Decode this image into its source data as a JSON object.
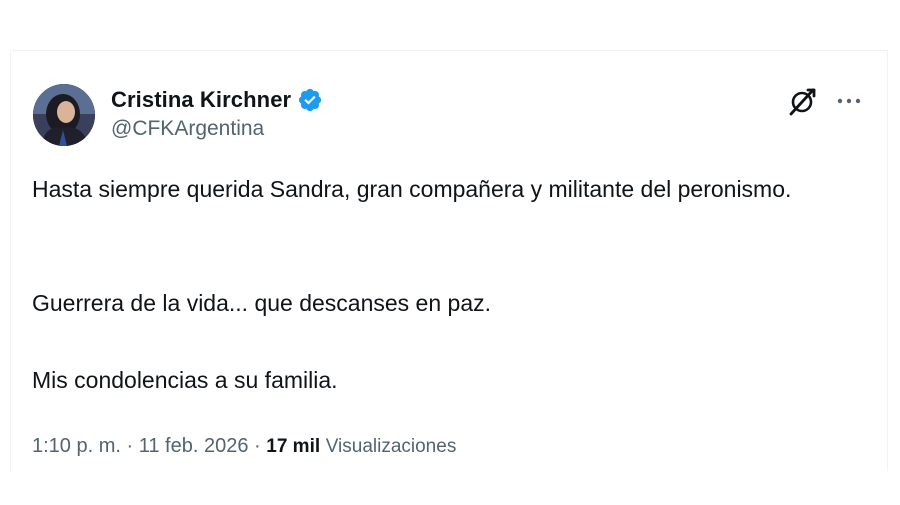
{
  "tweet": {
    "author": {
      "display_name": "Cristina Kirchner",
      "handle": "@CFKArgentina",
      "verified": true,
      "verified_color": "#1d9bf0"
    },
    "paragraphs": [
      "Hasta siempre querida Sandra, gran compañera y militante del peronismo.",
      "Guerrera de la vida... que descanses en paz.",
      "Mis condolencias a su familia."
    ],
    "time": "1:10 p. m.",
    "separator": "·",
    "date": "11 feb. 2026",
    "views_count": "17 mil",
    "views_label": "Visualizaciones"
  },
  "icons": {
    "grok": "grok-icon",
    "more": "more-options-icon",
    "verified": "verified-badge-icon"
  }
}
